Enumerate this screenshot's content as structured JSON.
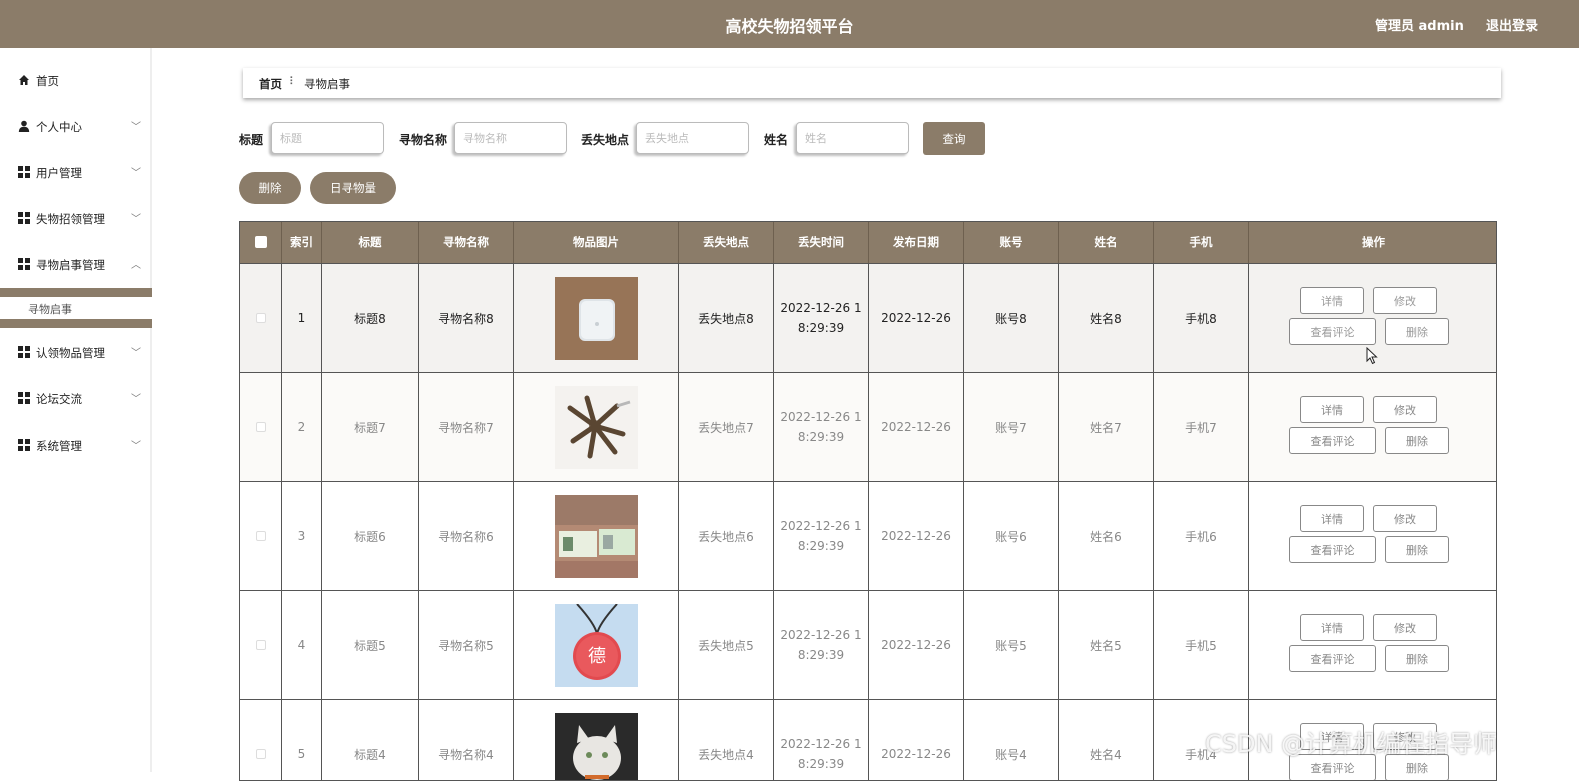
{
  "header": {
    "title": "高校失物招领平台",
    "admin_label": "管理员 admin",
    "logout_label": "退出登录"
  },
  "sidebar": {
    "items": [
      {
        "label": "首页",
        "icon": "home-icon"
      },
      {
        "label": "个人中心",
        "icon": "user-icon"
      },
      {
        "label": "用户管理",
        "icon": "grid-icon"
      },
      {
        "label": "失物招领管理",
        "icon": "grid-icon"
      },
      {
        "label": "寻物启事管理",
        "icon": "grid-icon"
      },
      {
        "label": "认领物品管理",
        "icon": "grid-icon"
      },
      {
        "label": "论坛交流",
        "icon": "grid-icon"
      },
      {
        "label": "系统管理",
        "icon": "grid-icon"
      }
    ],
    "submenu_label": "寻物启事"
  },
  "breadcrumb": {
    "home": "首页",
    "separator": "⠇",
    "current": "寻物启事"
  },
  "search": {
    "title_label": "标题",
    "title_placeholder": "标题",
    "name_label": "寻物名称",
    "name_placeholder": "寻物名称",
    "place_label": "丢失地点",
    "place_placeholder": "丢失地点",
    "person_label": "姓名",
    "person_placeholder": "姓名",
    "query_button": "查询"
  },
  "actions": {
    "delete_button": "删除",
    "daily_button": "日寻物量"
  },
  "table": {
    "headers": [
      "索引",
      "标题",
      "寻物名称",
      "物品图片",
      "丢失地点",
      "丢失时间",
      "发布日期",
      "账号",
      "姓名",
      "手机",
      "操作"
    ],
    "rows": [
      {
        "index": "1",
        "title": "标题8",
        "name": "寻物名称8",
        "image": "earbuds-case-photo",
        "place": "丢失地点8",
        "time_line1": "2022-12-26 1",
        "time_line2": "8:29:39",
        "date": "2022-12-26",
        "account": "账号8",
        "person": "姓名8",
        "phone": "手机8"
      },
      {
        "index": "2",
        "title": "标题7",
        "name": "寻物名称7",
        "image": "keys-photo",
        "place": "丢失地点7",
        "time_line1": "2022-12-26 1",
        "time_line2": "8:29:39",
        "date": "2022-12-26",
        "account": "账号7",
        "person": "姓名7",
        "phone": "手机7"
      },
      {
        "index": "3",
        "title": "标题6",
        "name": "寻物名称6",
        "image": "id-card-photo",
        "place": "丢失地点6",
        "time_line1": "2022-12-26 1",
        "time_line2": "8:29:39",
        "date": "2022-12-26",
        "account": "账号6",
        "person": "姓名6",
        "phone": "手机6"
      },
      {
        "index": "4",
        "title": "标题5",
        "name": "寻物名称5",
        "image": "tag-pendant-photo",
        "place": "丢失地点5",
        "time_line1": "2022-12-26 1",
        "time_line2": "8:29:39",
        "date": "2022-12-26",
        "account": "账号5",
        "person": "姓名5",
        "phone": "手机5"
      },
      {
        "index": "5",
        "title": "标题4",
        "name": "寻物名称4",
        "image": "cat-photo",
        "place": "丢失地点4",
        "time_line1": "2022-12-26 1",
        "time_line2": "8:29:39",
        "date": "2022-12-26",
        "account": "账号4",
        "person": "姓名4",
        "phone": "手机4"
      }
    ],
    "row_actions": {
      "detail": "详情",
      "edit": "修改",
      "comments": "查看评论",
      "delete": "删除"
    }
  },
  "watermark": "CSDN @计算机编程指导师",
  "colors": {
    "brand": "#8b7c69"
  }
}
